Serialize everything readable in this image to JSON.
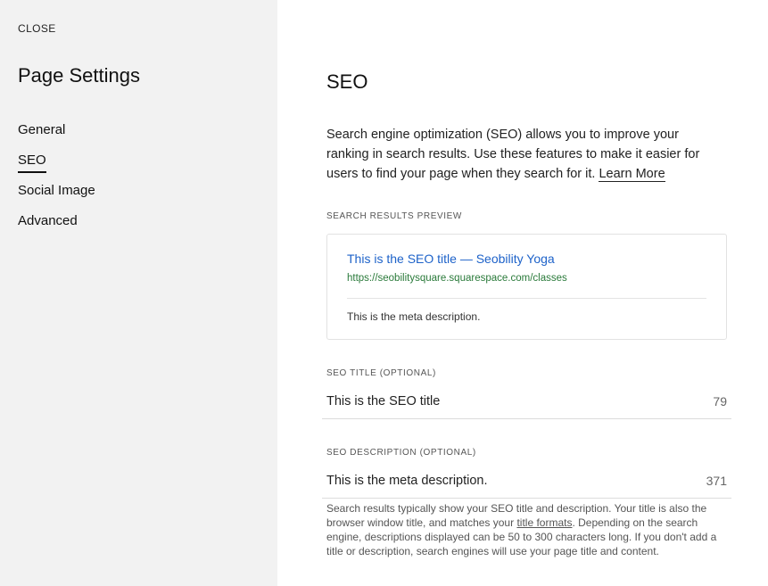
{
  "sidebar": {
    "close_label": "CLOSE",
    "title": "Page Settings",
    "items": [
      {
        "label": "General",
        "active": false
      },
      {
        "label": "SEO",
        "active": true
      },
      {
        "label": "Social Image",
        "active": false
      },
      {
        "label": "Advanced",
        "active": false
      }
    ]
  },
  "main": {
    "title": "SEO",
    "intro_text": "Search engine optimization (SEO) allows you to improve your ranking in search results. Use these features to make it easier for users to find your page when they search for it.",
    "learn_more_label": "Learn More",
    "preview": {
      "section_label": "SEARCH RESULTS PREVIEW",
      "title": "This is the SEO title — Seobility Yoga",
      "url": "https://seobilitysquare.squarespace.com/classes",
      "description": "This is the meta description."
    },
    "seo_title": {
      "label": "SEO TITLE (OPTIONAL)",
      "value": "This is the SEO title",
      "char_count": "79"
    },
    "seo_description": {
      "label": "SEO DESCRIPTION (OPTIONAL)",
      "value": "This is the meta description.",
      "char_count": "371"
    },
    "help": {
      "text_before": "Search results typically show your SEO title and description. Your title is also the browser window title, and matches your",
      "link_label": "title formats",
      "text_after": ". Depending on the search engine, descriptions displayed can be 50 to 300 characters long. If you don't add a title or description, search engines will use your page title and content."
    }
  },
  "colors": {
    "sidebar_bg": "#f2f2f2",
    "preview_title": "#1d62c9",
    "preview_url": "#2a7a3a"
  }
}
